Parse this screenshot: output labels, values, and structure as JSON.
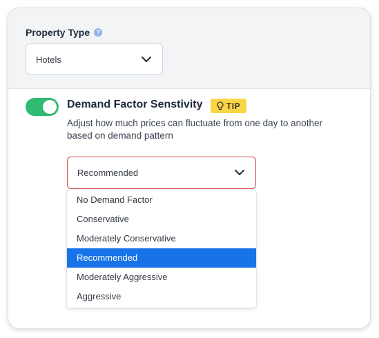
{
  "property_type": {
    "label": "Property Type",
    "info_icon": "info-icon",
    "info_glyph": "?",
    "selected_value": "Hotels"
  },
  "demand_factor": {
    "toggle_on": true,
    "title": "Demand Factor Senstivity",
    "tip_label": "TIP",
    "description": "Adjust how much prices can fluctuate from one day to another based on demand pattern",
    "selected_value": "Recommended",
    "options": [
      "No Demand Factor",
      "Conservative",
      "Moderately Conservative",
      "Recommended",
      "Moderately Aggressive",
      "Aggressive"
    ],
    "highlighted_option": "Recommended"
  },
  "colors": {
    "toggle_on": "#2fbb74",
    "tip_badge": "#f9d548",
    "select_error_border": "#d44a4a",
    "option_highlight": "#1873e8",
    "info_icon": "#8bb5e8"
  }
}
